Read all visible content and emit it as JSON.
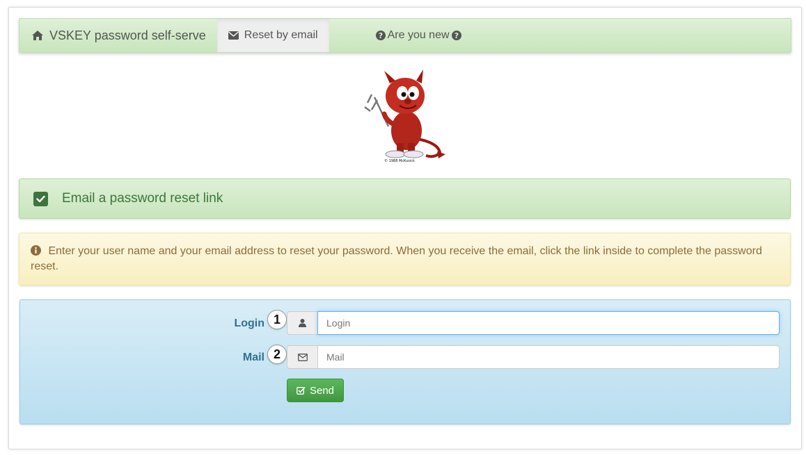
{
  "navbar": {
    "brand_label": "VSKEY password self-serve",
    "brand_icon": "home-icon",
    "active_label": "Reset by email",
    "active_icon": "envelope-icon",
    "new_label": "Are you new",
    "new_icon": "question-circle-icon"
  },
  "logo": {
    "caption": "© 1988 McKusick"
  },
  "success_alert": {
    "icon": "check-square-icon",
    "text": "Email a password reset link"
  },
  "info_alert": {
    "icon": "info-circle-icon",
    "text": "Enter your user name and your email address to reset your password. When you receive the email, click the link inside to complete the password reset."
  },
  "form": {
    "login_label": "Login",
    "login_badge": "1",
    "login_placeholder": "Login",
    "login_value": "",
    "login_icon": "user-icon",
    "mail_label": "Mail",
    "mail_badge": "2",
    "mail_placeholder": "Mail",
    "mail_value": "",
    "mail_icon": "envelope-outline-icon",
    "send_label": "Send",
    "send_icon": "check-square-outline-icon"
  },
  "colors": {
    "navbar_bg": "#dff0d8",
    "success_text": "#3c763d",
    "warning_text": "#8a6d3b",
    "info_text": "#31708f",
    "send_button": "#5cb85c"
  }
}
